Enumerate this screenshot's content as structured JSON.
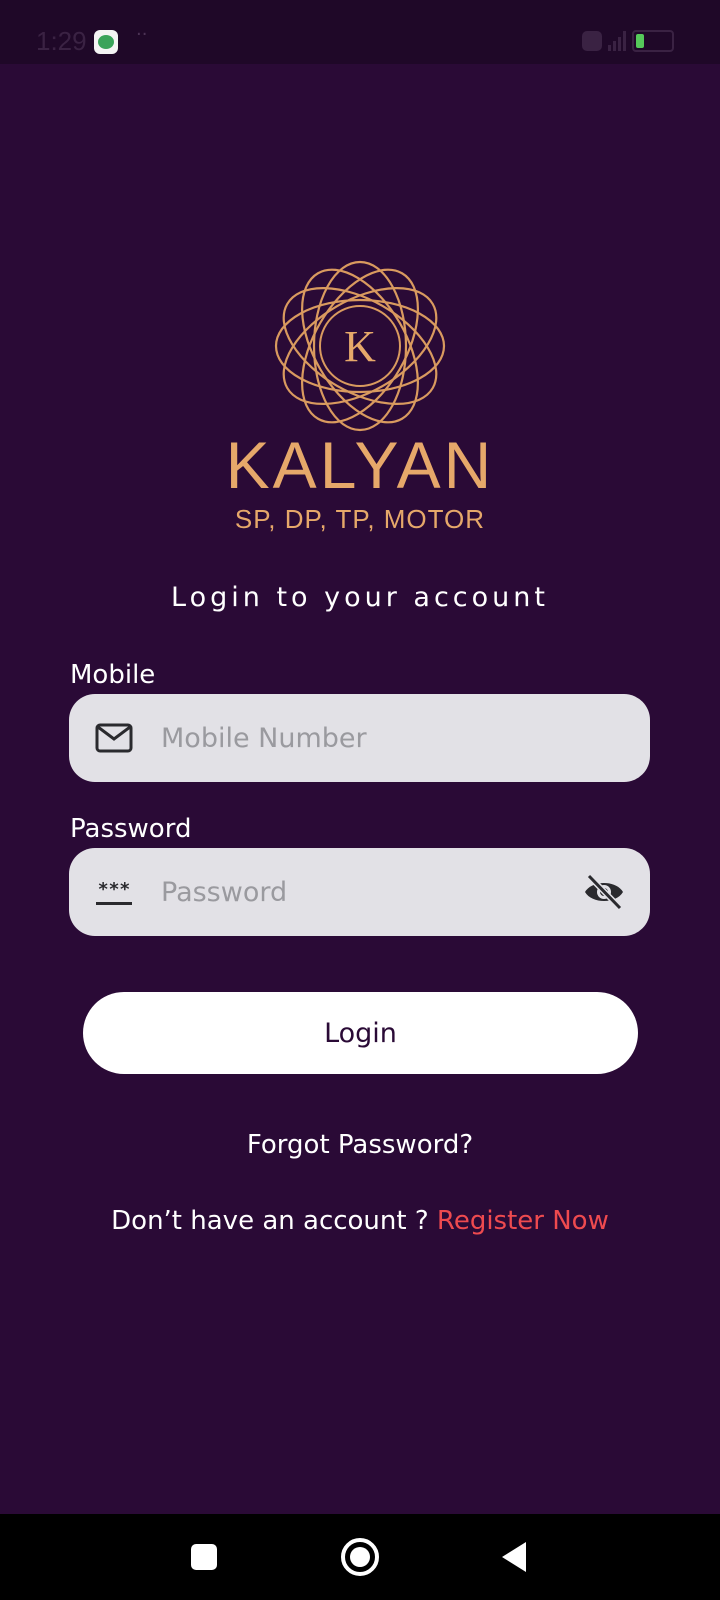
{
  "status_bar": {
    "time": "1:29",
    "dots": "··"
  },
  "brand": {
    "logo_letter": "K",
    "name": "KALYAN",
    "tagline": "SP, DP, TP, MOTOR",
    "color": "#e6a86a"
  },
  "login": {
    "heading": "Login to your account",
    "mobile_label": "Mobile",
    "mobile_placeholder": "Mobile Number",
    "mobile_value": "",
    "password_label": "Password",
    "password_placeholder": "Password",
    "password_value": "",
    "password_icon_text": "***",
    "button_label": "Login",
    "forgot_password": "Forgot Password?",
    "no_account_text": "Don’t have an account ? ",
    "register_link": "Register Now"
  },
  "icons": {
    "mobile_field": "mail-icon",
    "password_field": "password-dots-icon",
    "visibility_toggle": "eye-off-icon"
  },
  "colors": {
    "background": "#2a0a36",
    "field_background": "#e2e1e6",
    "register_link": "#ee4a4f",
    "button_background": "#ffffff"
  }
}
